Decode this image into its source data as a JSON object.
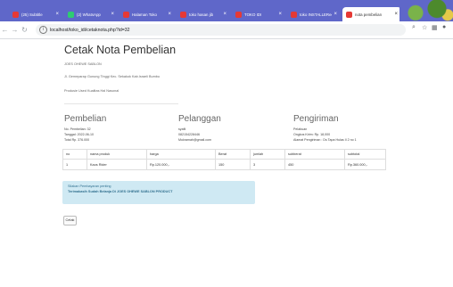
{
  "browser": {
    "tabs": [
      {
        "label": "(25) Subtitle",
        "active": false,
        "color": "#e53935"
      },
      {
        "label": "(2) WhatsApp",
        "active": false,
        "color": "#2ecc71"
      },
      {
        "label": "Halaman Toko",
        "active": false,
        "color": "#e53935"
      },
      {
        "label": "toko hasan jib",
        "active": false,
        "color": "#e53935"
      },
      {
        "label": "TOKO IDI",
        "active": false,
        "color": "#e53935"
      },
      {
        "label": "toko INSTALLERee",
        "active": false,
        "color": "#e53935"
      },
      {
        "label": "nota pembelian",
        "active": true,
        "color": "#e53935"
      }
    ],
    "url": "localhost/toko_idi/cetaknota.php?id=32"
  },
  "page": {
    "title": "Cetak Nota Pembelian",
    "store_name": "JOES OHEWE SABLON",
    "address": "Jl. Gemeparap Gunung Tinggi Kec. Sekakok Kab.Israeli Bumbu",
    "tagline": "Produsie Used Kualitas Hal Nasonal",
    "pembelian": {
      "heading": "Pembelian",
      "lines": [
        "No. Pembelian: 32",
        "Tanggal: 2022-06-10",
        "Total Rp. 376.000"
      ]
    },
    "pelanggan": {
      "heading": "Pelanggan",
      "lines": [
        "syafii",
        "082154228446",
        "Mukramah@gmail.com"
      ]
    },
    "pengiriman": {
      "heading": "Pengiriman",
      "lines": [
        "Pelabuan",
        "Ongkos Kirim: Rp. 18,000",
        "Alamat Pengiriman : Ds Tapa Hulas II 2 no 1"
      ]
    },
    "table": {
      "headers": [
        "no",
        "nama produk",
        "harga",
        "Berat",
        "jumlah",
        "subberat",
        "subtotal"
      ],
      "rows": [
        [
          "1",
          "Kaos Rider",
          "Rp.120.000,-",
          "150",
          "3",
          "450",
          "Rp.360.000,-"
        ]
      ]
    },
    "alert": {
      "line1": "Silakan Pembayaran penting",
      "line2": "Terimakasih Sudah Belanja Di JOES OHEWE SABLON PRODUCT"
    },
    "print_label": "Cetak"
  }
}
